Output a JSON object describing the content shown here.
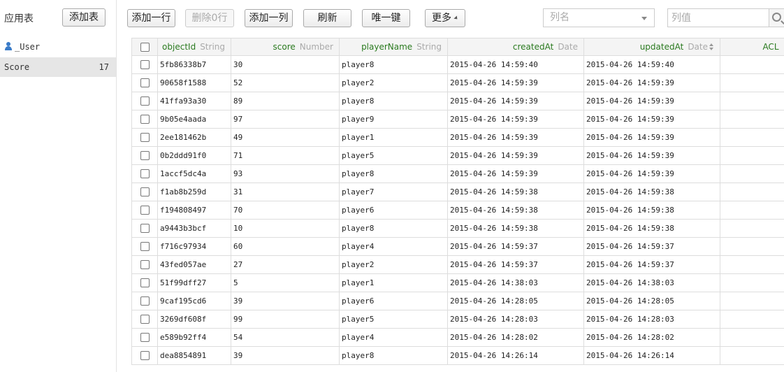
{
  "sidebar": {
    "title": "应用表",
    "add_table_label": "添加表",
    "items": [
      {
        "label": "_User",
        "count": ""
      },
      {
        "label": "Score",
        "count": "17"
      }
    ]
  },
  "toolbar": {
    "add_row": "添加一行",
    "delete_rows": "删除0行",
    "add_column": "添加一列",
    "refresh": "刷新",
    "unique_key": "唯一键",
    "more": "更多",
    "column_select_placeholder": "列名",
    "value_placeholder": "列值"
  },
  "table": {
    "columns": [
      {
        "name": "objectId",
        "type": "String"
      },
      {
        "name": "score",
        "type": "Number"
      },
      {
        "name": "playerName",
        "type": "String"
      },
      {
        "name": "createdAt",
        "type": "Date"
      },
      {
        "name": "updatedAt",
        "type": "Date"
      },
      {
        "name": "ACL",
        "type": ""
      }
    ],
    "rows": [
      [
        "5fb86338b7",
        "30",
        "player8",
        "2015-04-26 14:59:40",
        "2015-04-26 14:59:40",
        ""
      ],
      [
        "90658f1588",
        "52",
        "player2",
        "2015-04-26 14:59:39",
        "2015-04-26 14:59:39",
        ""
      ],
      [
        "41ffa93a30",
        "89",
        "player8",
        "2015-04-26 14:59:39",
        "2015-04-26 14:59:39",
        ""
      ],
      [
        "9b05e4aada",
        "97",
        "player9",
        "2015-04-26 14:59:39",
        "2015-04-26 14:59:39",
        ""
      ],
      [
        "2ee181462b",
        "49",
        "player1",
        "2015-04-26 14:59:39",
        "2015-04-26 14:59:39",
        ""
      ],
      [
        "0b2ddd91f0",
        "71",
        "player5",
        "2015-04-26 14:59:39",
        "2015-04-26 14:59:39",
        ""
      ],
      [
        "1accf5dc4a",
        "93",
        "player8",
        "2015-04-26 14:59:39",
        "2015-04-26 14:59:39",
        ""
      ],
      [
        "f1ab8b259d",
        "31",
        "player7",
        "2015-04-26 14:59:38",
        "2015-04-26 14:59:38",
        ""
      ],
      [
        "f194808497",
        "70",
        "player6",
        "2015-04-26 14:59:38",
        "2015-04-26 14:59:38",
        ""
      ],
      [
        "a9443b3bcf",
        "10",
        "player8",
        "2015-04-26 14:59:38",
        "2015-04-26 14:59:38",
        ""
      ],
      [
        "f716c97934",
        "60",
        "player4",
        "2015-04-26 14:59:37",
        "2015-04-26 14:59:37",
        ""
      ],
      [
        "43fed057ae",
        "27",
        "player2",
        "2015-04-26 14:59:37",
        "2015-04-26 14:59:37",
        ""
      ],
      [
        "51f99dff27",
        "5",
        "player1",
        "2015-04-26 14:38:03",
        "2015-04-26 14:38:03",
        ""
      ],
      [
        "9caf195cd6",
        "39",
        "player6",
        "2015-04-26 14:28:05",
        "2015-04-26 14:28:05",
        ""
      ],
      [
        "3269df608f",
        "99",
        "player5",
        "2015-04-26 14:28:03",
        "2015-04-26 14:28:03",
        ""
      ],
      [
        "e589b92ff4",
        "54",
        "player4",
        "2015-04-26 14:28:02",
        "2015-04-26 14:28:02",
        ""
      ],
      [
        "dea8854891",
        "39",
        "player8",
        "2015-04-26 14:26:14",
        "2015-04-26 14:26:14",
        ""
      ]
    ]
  },
  "colors": {
    "header_name": "#2a7a1f",
    "header_type": "#aaaaaa",
    "selected_item_bg": "#e6e6e6",
    "user_icon": "#3a7bc8"
  },
  "icons": {
    "user": "user-icon",
    "sort": "sort-icon",
    "search": "search-icon",
    "dropdown": "chevron-down-icon"
  }
}
